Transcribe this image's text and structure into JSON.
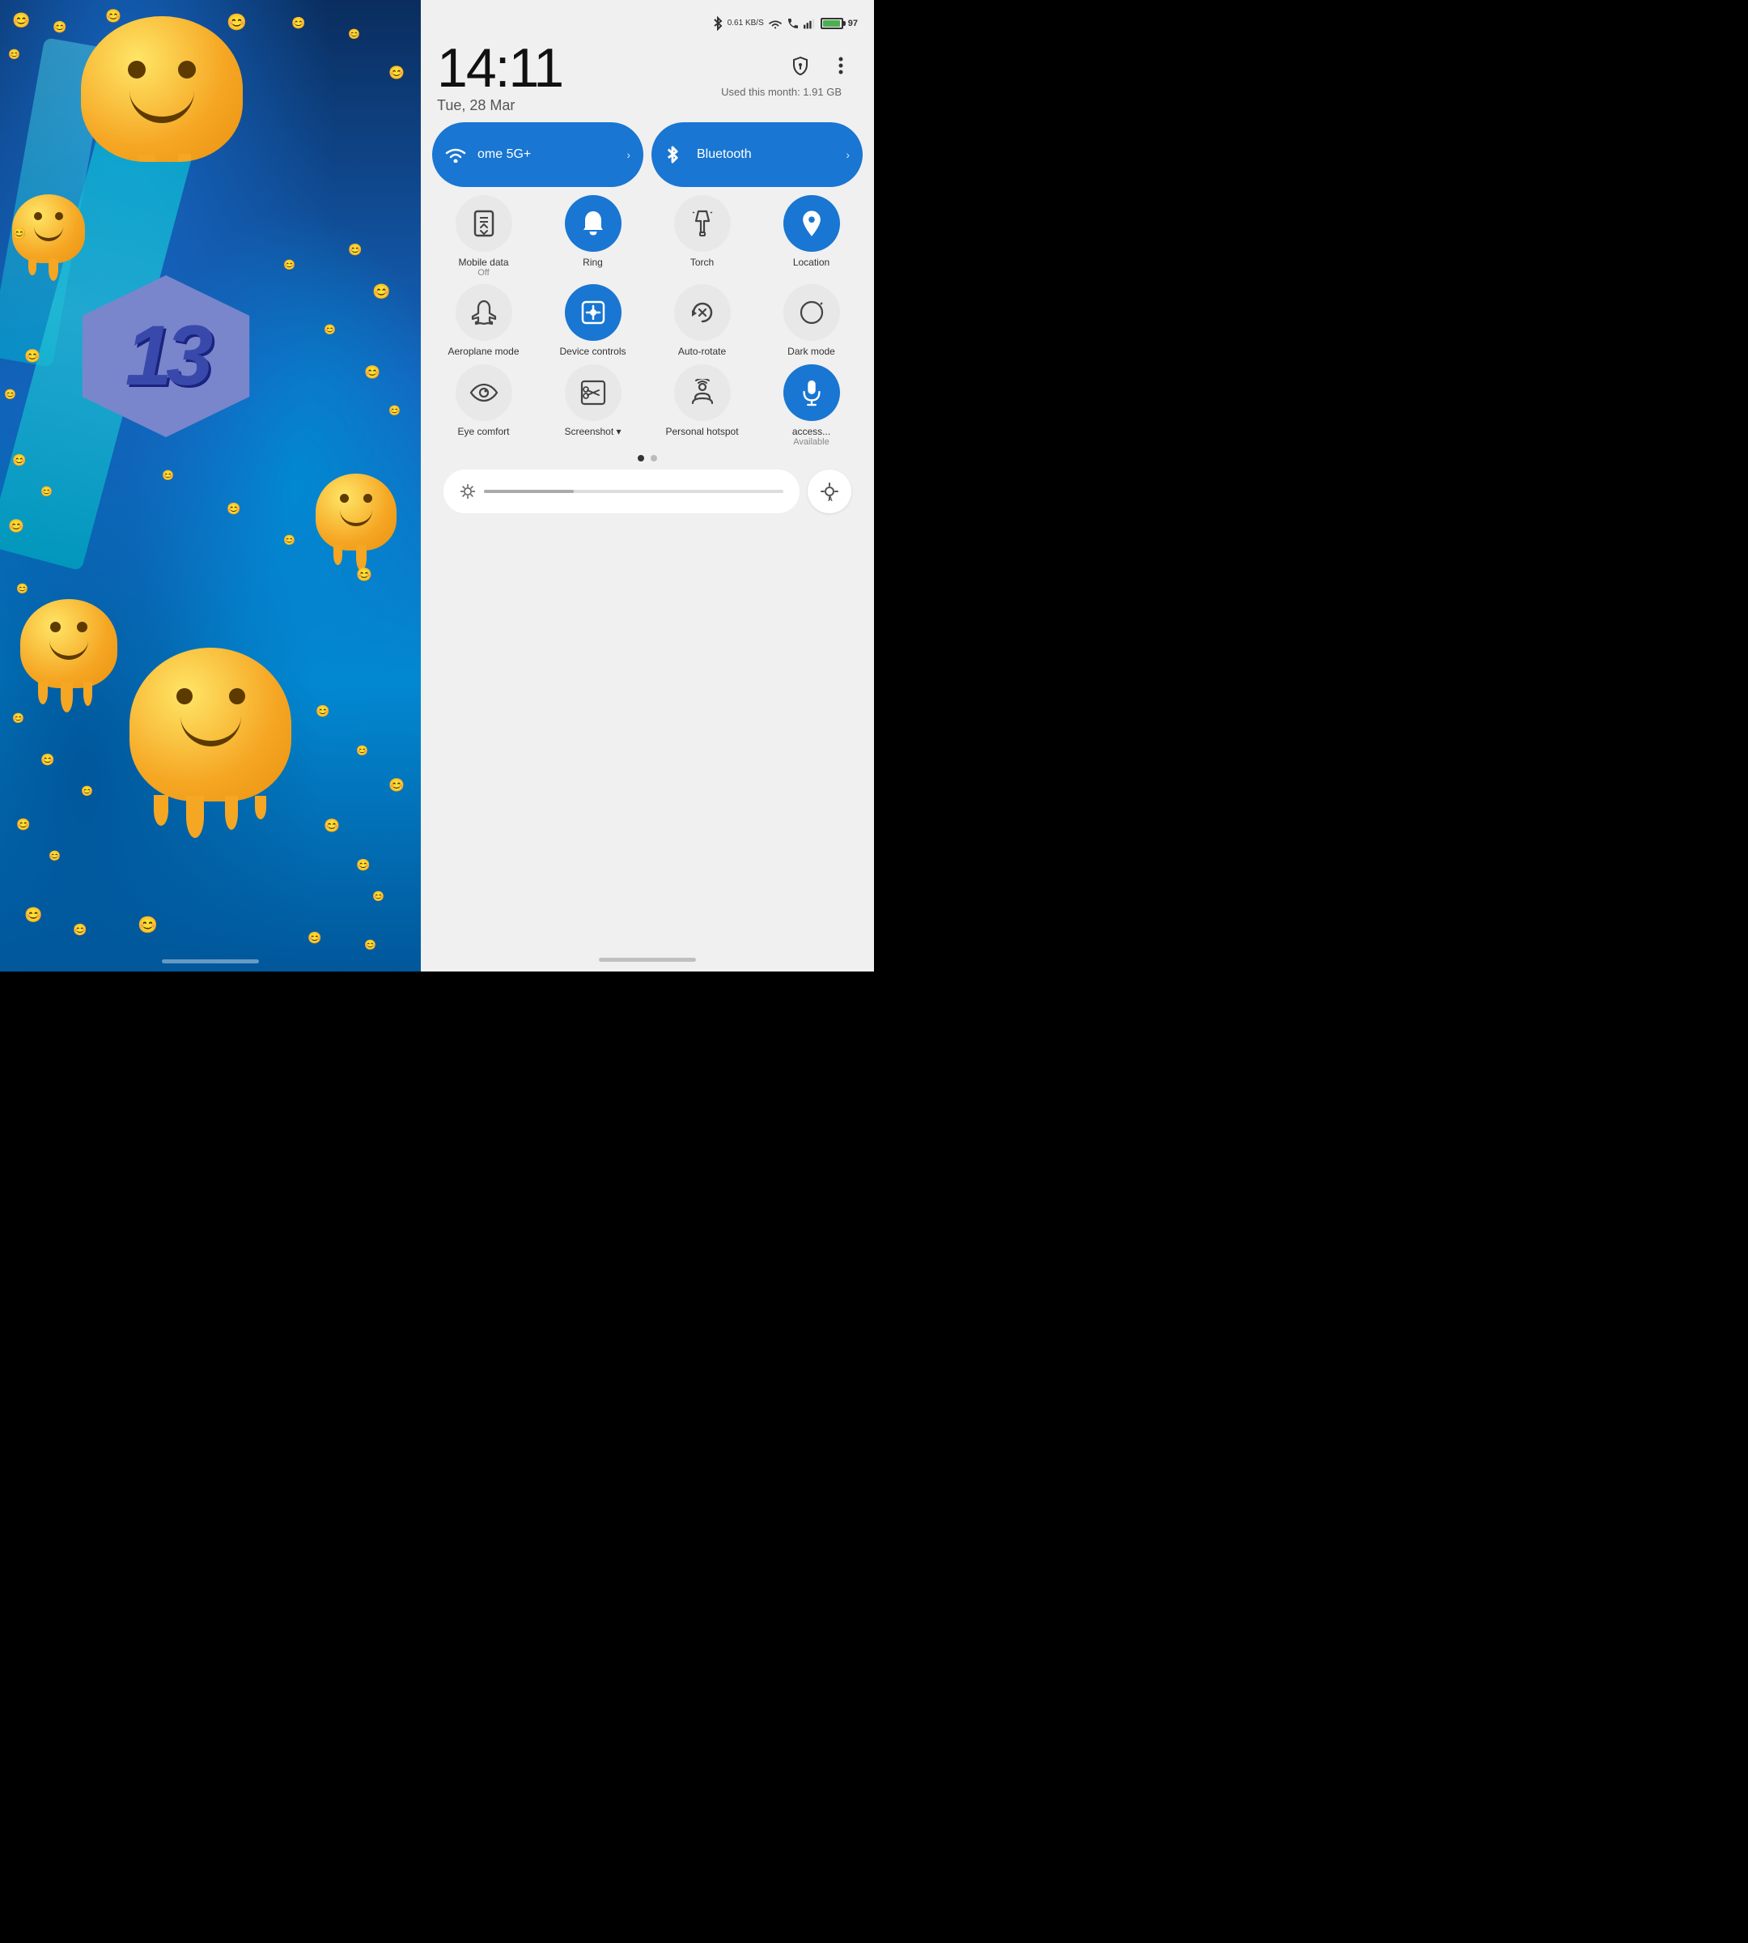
{
  "left": {
    "label": "wallpaper-panel"
  },
  "right": {
    "statusBar": {
      "bluetooth": "⊕",
      "speed": "0.61 KB/S",
      "wifi": "WiFi",
      "call": "call",
      "signal": "signal",
      "battery_level": "97",
      "battery_label": "97"
    },
    "header": {
      "time": "14:11",
      "date": "Tue, 28 Mar",
      "data_usage": "Used this month: 1.91 GB",
      "shield_icon": "⊙",
      "menu_icon": "⋮"
    },
    "tiles": {
      "wifi": {
        "label": "ome 5G+",
        "active": true
      },
      "bluetooth": {
        "label": "Bluetooth",
        "active": true
      },
      "grid": [
        {
          "id": "mobile-data",
          "icon": "mobile",
          "label": "Mobile data",
          "sublabel": "Off",
          "active": false
        },
        {
          "id": "ring",
          "icon": "ring",
          "label": "Ring",
          "sublabel": "",
          "active": true
        },
        {
          "id": "torch",
          "icon": "torch",
          "label": "Torch",
          "sublabel": "",
          "active": false
        },
        {
          "id": "location",
          "icon": "location",
          "label": "Location",
          "sublabel": "",
          "active": true
        },
        {
          "id": "aeroplane",
          "icon": "aeroplane",
          "label": "Aeroplane mode",
          "sublabel": "",
          "active": false
        },
        {
          "id": "device-controls",
          "icon": "device",
          "label": "Device controls",
          "sublabel": "",
          "active": true
        },
        {
          "id": "auto-rotate",
          "icon": "rotate",
          "label": "Auto-rotate",
          "sublabel": "",
          "active": false
        },
        {
          "id": "dark-mode",
          "icon": "dark",
          "label": "Dark mode",
          "sublabel": "",
          "active": false
        },
        {
          "id": "eye-comfort",
          "icon": "eye",
          "label": "Eye comfort",
          "sublabel": "",
          "active": false
        },
        {
          "id": "screenshot",
          "icon": "screenshot",
          "label": "Screenshot ▾",
          "sublabel": "",
          "active": false
        },
        {
          "id": "personal-hotspot",
          "icon": "hotspot",
          "label": "Personal hotspot",
          "sublabel": "",
          "active": false
        },
        {
          "id": "accessibility",
          "icon": "mic",
          "label": "access...",
          "sublabel": "Available",
          "active": true
        }
      ]
    },
    "pageDots": [
      {
        "active": true
      },
      {
        "active": false
      }
    ],
    "brightness": {
      "level": 30,
      "auto_icon": "☀A"
    }
  }
}
